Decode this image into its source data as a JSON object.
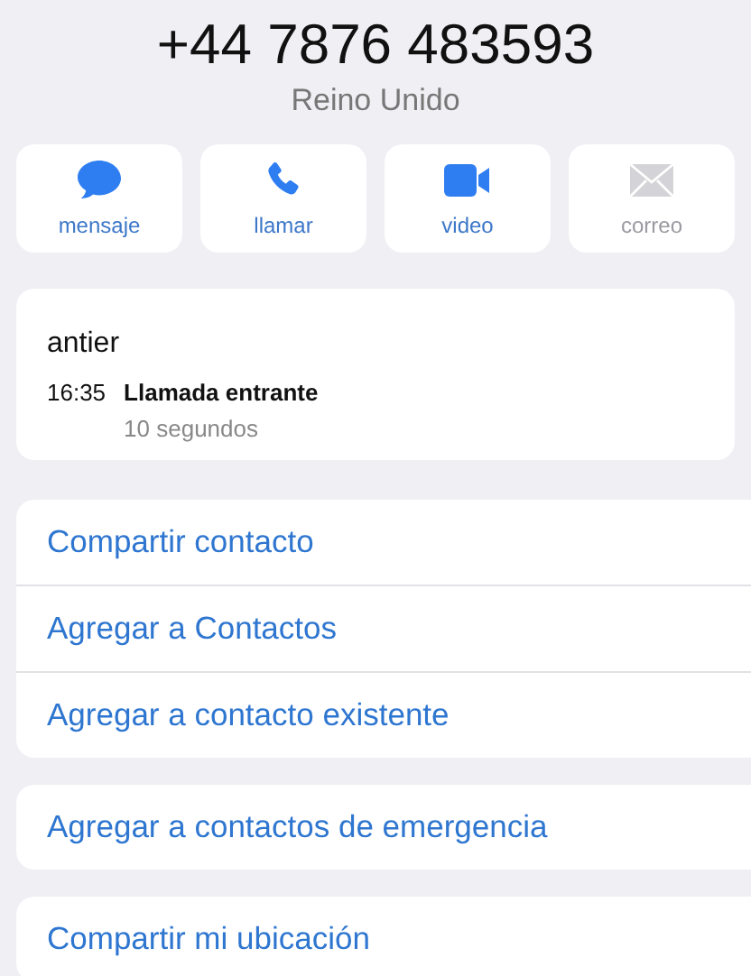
{
  "header": {
    "phone": "+44 7876 483593",
    "country": "Reino Unido"
  },
  "actions": [
    {
      "kind": "message",
      "label": "mensaje",
      "disabled": false
    },
    {
      "kind": "call",
      "label": "llamar",
      "disabled": false
    },
    {
      "kind": "video",
      "label": "video",
      "disabled": false
    },
    {
      "kind": "mail",
      "label": "correo",
      "disabled": true
    }
  ],
  "recents": {
    "day": "antier",
    "calls": [
      {
        "time": "16:35",
        "type": "Llamada entrante",
        "duration": "10 segundos"
      }
    ]
  },
  "groups": [
    [
      "Compartir contacto",
      "Agregar a Contactos",
      "Agregar a contacto existente"
    ],
    [
      "Agregar a contactos de emergencia"
    ],
    [
      "Compartir mi ubicación"
    ]
  ]
}
